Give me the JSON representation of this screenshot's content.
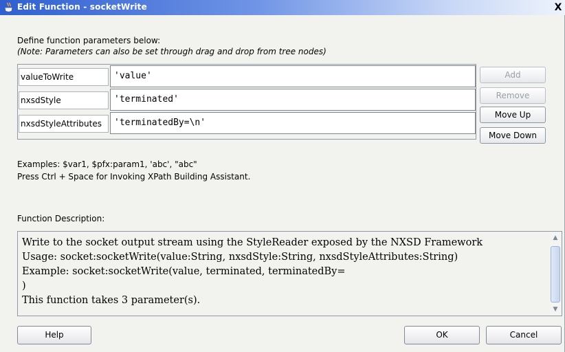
{
  "window": {
    "title": "Edit Function - socketWrite",
    "close_label": "X"
  },
  "intro": {
    "line1": "Define function parameters below:",
    "line2": "(Note: Parameters can also be set through drag and drop from tree nodes)"
  },
  "parameters": [
    {
      "name": "valueToWrite",
      "value": "'value'"
    },
    {
      "name": "nxsdStyle",
      "value": "'terminated'"
    },
    {
      "name": "nxsdStyleAttributes",
      "value": "'terminatedBy=\\n'"
    }
  ],
  "side_buttons": {
    "add": {
      "label": "Add",
      "enabled": false
    },
    "remove": {
      "label": "Remove",
      "enabled": false
    },
    "move_up": {
      "label": "Move Up",
      "enabled": true
    },
    "move_down": {
      "label": "Move Down",
      "enabled": true
    }
  },
  "examples": {
    "line1": "Examples: $var1, $pfx:param1, 'abc', \"abc\"",
    "line2": "Press Ctrl + Space for Invoking XPath Building Assistant."
  },
  "description": {
    "label": "Function Description:",
    "text": "Write to the socket output stream using the StyleReader exposed by the NXSD Framework\nUsage: socket:socketWrite(value:String, nxsdStyle:String, nxsdStyleAttributes:String)\nExample: socket:socketWrite(value, terminated, terminatedBy=\n)\nThis function takes 3 parameter(s)."
  },
  "buttons": {
    "help": "Help",
    "ok": "OK",
    "cancel": "Cancel"
  },
  "icons": {
    "title": "coffee-cup-icon",
    "close": "close-icon",
    "scroll_up": "arrow-up-icon",
    "scroll_down": "arrow-down-icon"
  }
}
